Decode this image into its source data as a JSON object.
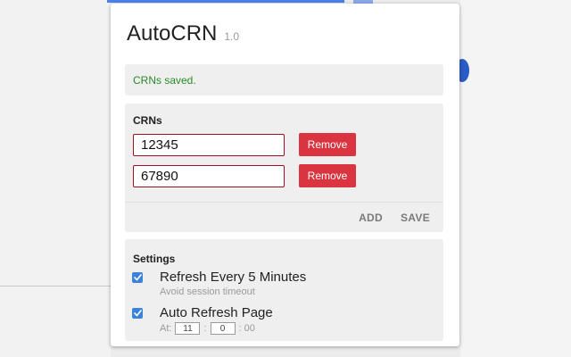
{
  "popup": {
    "title": "AutoCRN",
    "version": "1.0",
    "status_message": "CRNs saved."
  },
  "crns": {
    "heading": "CRNs",
    "entries": [
      {
        "value": "12345",
        "remove_label": "Remove"
      },
      {
        "value": "67890",
        "remove_label": "Remove"
      }
    ],
    "add_label": "ADD",
    "save_label": "SAVE"
  },
  "settings": {
    "heading": "Settings",
    "refresh_every": {
      "label": "Refresh Every 5 Minutes",
      "hint": "Avoid session timeout",
      "checked": true
    },
    "auto_refresh": {
      "label": "Auto Refresh Page",
      "checked": true,
      "at_label": "At:",
      "hour": "11",
      "separator_1": ":",
      "minute": "0",
      "separator_2": ":",
      "seconds": "00"
    }
  },
  "colors": {
    "status_text": "#2a8a2a",
    "remove_button": "#d9343f",
    "input_border": "#a30f1f",
    "checkbox": "#3b82db",
    "action_link": "#7a7a7a"
  },
  "icons": {
    "checkbox_check": "checkmark-icon"
  }
}
